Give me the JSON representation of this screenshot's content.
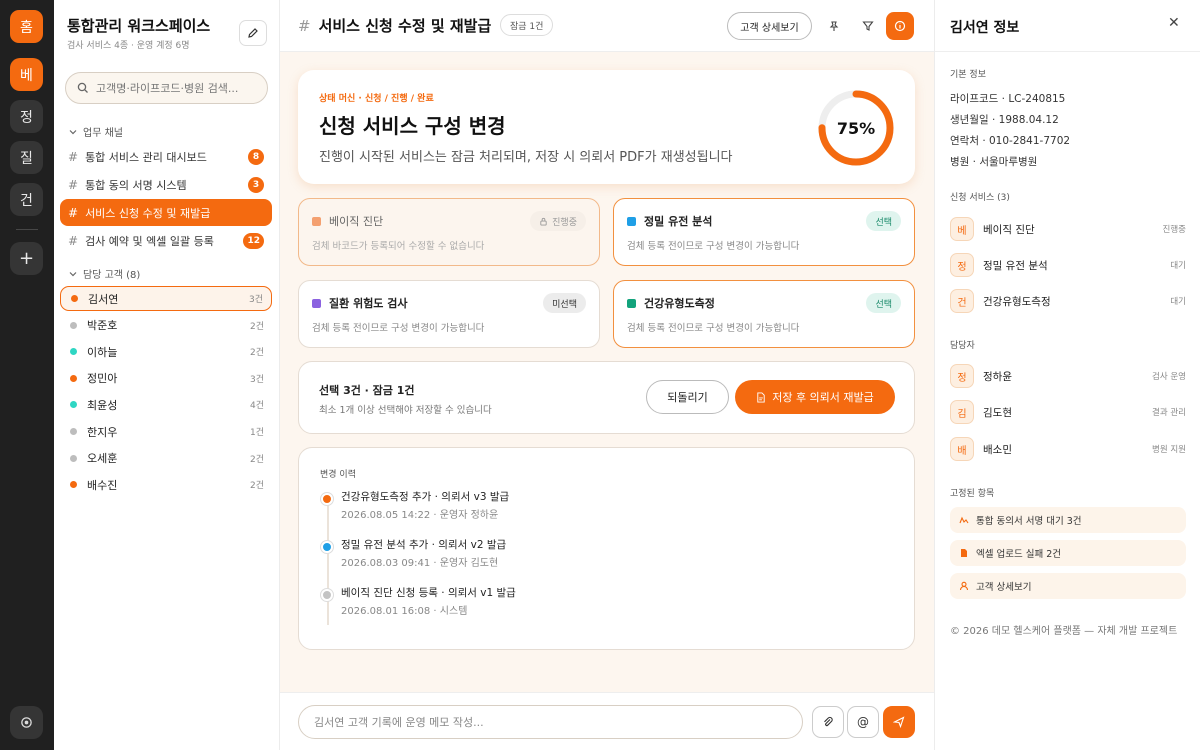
{
  "rail": {
    "logo": "홈",
    "items": [
      "베",
      "정",
      "질",
      "건"
    ],
    "add": "+"
  },
  "sidebar": {
    "title": "통합관리 워크스페이스",
    "subtitle": "검사 서비스 4종 · 운영 계정 6명",
    "search_placeholder": "고객명·라이프코드·병원 검색...",
    "channels_label": "업무 채널",
    "channels": [
      {
        "label": "통합 서비스 관리 대시보드",
        "count": "8"
      },
      {
        "label": "통합 동의 서명 시스템",
        "count": "3"
      },
      {
        "label": "서비스 신청 수정 및 재발급",
        "count": ""
      },
      {
        "label": "검사 예약 및 엑셀 일괄 등록",
        "count": "12"
      }
    ],
    "customers_label": "담당 고객 (8)",
    "customers": [
      {
        "name": "김서연",
        "count": "3건",
        "color": "#f46a10"
      },
      {
        "name": "박준호",
        "count": "2건",
        "color": "#bdbdbd"
      },
      {
        "name": "이하늘",
        "count": "2건",
        "color": "#2fd6c3"
      },
      {
        "name": "정민아",
        "count": "3건",
        "color": "#f46a10"
      },
      {
        "name": "최윤성",
        "count": "4건",
        "color": "#2fd6c3"
      },
      {
        "name": "한지우",
        "count": "1건",
        "color": "#bdbdbd"
      },
      {
        "name": "오세훈",
        "count": "2건",
        "color": "#bdbdbd"
      },
      {
        "name": "배수진",
        "count": "2건",
        "color": "#f46a10"
      }
    ]
  },
  "topbar": {
    "title": "서비스 신청 수정 및 재발급",
    "lock_badge": "잠금 1건",
    "detail_button": "고객 상세보기"
  },
  "hero": {
    "kicker": "상태 머신 · 신청 / 진행 / 완료",
    "title": "신청 서비스 구성 변경",
    "desc": "진행이 시작된 서비스는 잠금 처리되며, 저장 시 의뢰서 PDF가 재생성됩니다",
    "progress": 0.75,
    "progress_label": "75%"
  },
  "services": [
    {
      "name": "베이직 진단",
      "desc": "검체 바코드가 등록되어 수정할 수 없습니다",
      "badge": "진행중",
      "state": "locked",
      "color": "#f4a070"
    },
    {
      "name": "정밀 유전 분석",
      "desc": "검체 등록 전이므로 구성 변경이 가능합니다",
      "badge": "선택",
      "state": "selected",
      "color": "#1f9fe6"
    },
    {
      "name": "질환 위험도 검사",
      "desc": "검체 등록 전이므로 구성 변경이 가능합니다",
      "badge": "미선택",
      "state": "unselected",
      "color": "#8b62e0"
    },
    {
      "name": "건강유형도측정",
      "desc": "검체 등록 전이므로 구성 변경이 가능합니다",
      "badge": "선택",
      "state": "selected",
      "color": "#13a37c"
    }
  ],
  "actionbar": {
    "summary": "선택 3건 · 잠금 1건",
    "hint": "최소 1개 이상 선택해야 저장할 수 있습니다",
    "revert": "되돌리기",
    "save": "저장 후 의뢰서 재발급"
  },
  "history": {
    "title": "변경 이력",
    "events": [
      {
        "title": "건강유형도측정 추가 · 의뢰서 v3 발급",
        "meta": "2026.08.05 14:22 · 운영자 정하윤",
        "color": "#f46a10"
      },
      {
        "title": "정밀 유전 분석 추가 · 의뢰서 v2 발급",
        "meta": "2026.08.03 09:41 · 운영자 김도현",
        "color": "#1f9fe6"
      },
      {
        "title": "베이직 진단 신청 등록 · 의뢰서 v1 발급",
        "meta": "2026.08.01 16:08 · 시스템",
        "color": "#c4c4c4"
      }
    ]
  },
  "compose": {
    "placeholder": "김서연 고객 기록에 운영 메모 작성..."
  },
  "right": {
    "title": "김서연 정보",
    "basic_label": "기본 정보",
    "basic": [
      "라이프코드 · LC-240815",
      "생년월일 · 1988.04.12",
      "연락처 · 010-2841-7702",
      "병원 · 서울마루병원"
    ],
    "services_label": "신청 서비스 (3)",
    "services": [
      {
        "avatar": "베",
        "name": "베이직 진단",
        "status": "진행중"
      },
      {
        "avatar": "정",
        "name": "정밀 유전 분석",
        "status": "대기"
      },
      {
        "avatar": "건",
        "name": "건강유형도측정",
        "status": "대기"
      }
    ],
    "managers_label": "담당자",
    "managers": [
      {
        "avatar": "정",
        "name": "정하윤",
        "role": "검사 운영"
      },
      {
        "avatar": "김",
        "name": "김도현",
        "role": "결과 관리"
      },
      {
        "avatar": "배",
        "name": "배소민",
        "role": "병원 지원"
      }
    ],
    "pinned_label": "고정된 항목",
    "pinned": [
      "통합 동의서 서명 대기 3건",
      "엑셀 업로드 실패 2건",
      "고객 상세보기"
    ],
    "footer": "© 2026 데모 헬스케어 플랫폼 — 자체 개발 프로젝트"
  }
}
